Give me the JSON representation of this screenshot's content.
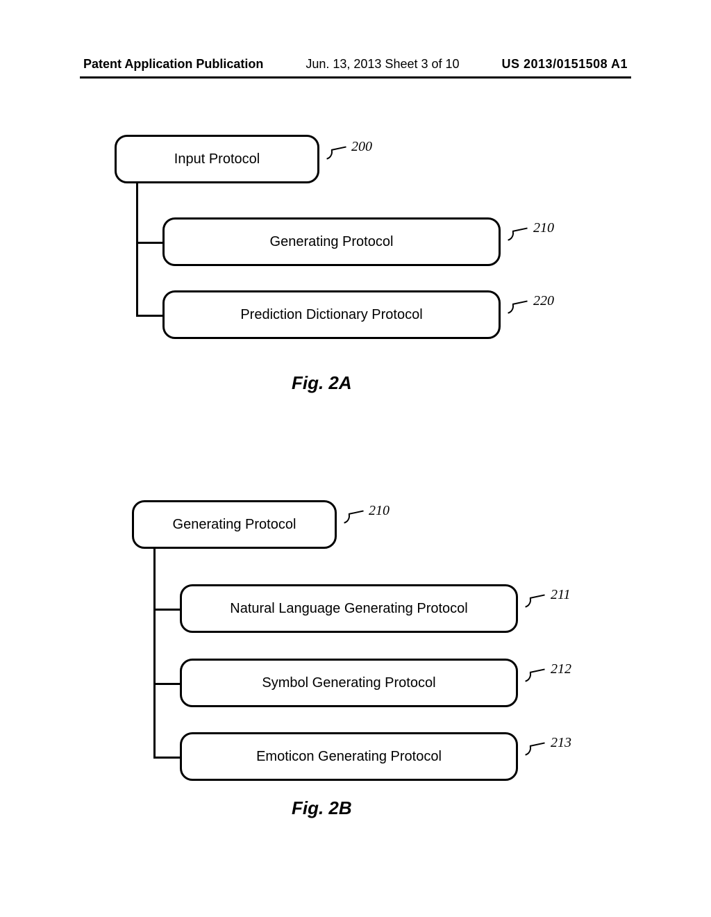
{
  "header": {
    "left": "Patent Application Publication",
    "mid": "Jun. 13, 2013  Sheet 3 of 10",
    "right": "US 2013/0151508 A1"
  },
  "figA": {
    "caption": "Fig. 2A",
    "boxes": {
      "input": {
        "label": "Input Protocol",
        "ref": "200"
      },
      "generating": {
        "label": "Generating Protocol",
        "ref": "210"
      },
      "prediction": {
        "label": "Prediction Dictionary Protocol",
        "ref": "220"
      }
    }
  },
  "figB": {
    "caption": "Fig. 2B",
    "boxes": {
      "generating": {
        "label": "Generating Protocol",
        "ref": "210"
      },
      "natural": {
        "label": "Natural Language Generating Protocol",
        "ref": "211"
      },
      "symbol": {
        "label": "Symbol Generating Protocol",
        "ref": "212"
      },
      "emoticon": {
        "label": "Emoticon Generating Protocol",
        "ref": "213"
      }
    }
  }
}
